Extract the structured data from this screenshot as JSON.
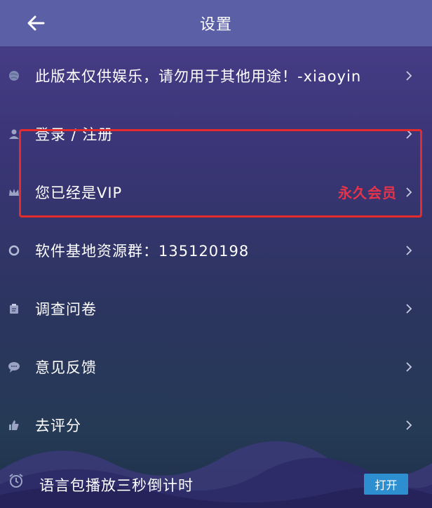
{
  "header": {
    "title": "设置"
  },
  "rows": [
    {
      "label": "此版本仅供娱乐，请勿用于其他用途！-xiaoyin",
      "icon": "globe-icon"
    },
    {
      "label": "登录 / 注册",
      "icon": "user-icon"
    },
    {
      "label": "您已经是VIP",
      "icon": "crown-icon",
      "extra": "永久会员"
    },
    {
      "label": "软件基地资源群：135120198",
      "icon": "circle-icon"
    },
    {
      "label": "调查问卷",
      "icon": "clipboard-icon"
    },
    {
      "label": "意见反馈",
      "icon": "chat-bubble-icon"
    },
    {
      "label": "去评分",
      "icon": "thumb-up-icon"
    }
  ],
  "bottom": {
    "label": "语言包播放三秒倒计时",
    "toggle_label": "打开",
    "icon": "alarm-clock-icon"
  },
  "colors": {
    "header_bg": "#5b5fa6",
    "vip_highlight": "#e52b2b",
    "vip_text": "#e8334a",
    "toggle_bg": "#2d8fd0"
  }
}
